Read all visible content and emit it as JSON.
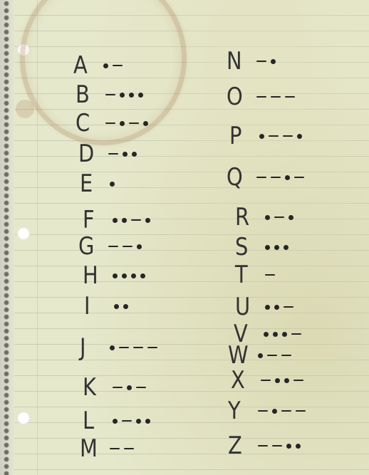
{
  "notebook": {
    "left_column": [
      {
        "letter": "A",
        "code": ".-"
      },
      {
        "letter": "B",
        "code": "-..."
      },
      {
        "letter": "C",
        "code": "-.-."
      },
      {
        "letter": "D",
        "code": "-.."
      },
      {
        "letter": "E",
        "code": "."
      },
      {
        "letter": "F",
        "code": "..-."
      },
      {
        "letter": "G",
        "code": "--."
      },
      {
        "letter": "H",
        "code": "...."
      },
      {
        "letter": "I",
        "code": ".."
      },
      {
        "letter": "J",
        "code": ".---"
      },
      {
        "letter": "K",
        "code": "-.-"
      },
      {
        "letter": "L",
        "code": ".-.."
      },
      {
        "letter": "M",
        "code": "--"
      }
    ],
    "right_column": [
      {
        "letter": "N",
        "code": "-."
      },
      {
        "letter": "O",
        "code": "---"
      },
      {
        "letter": "P",
        "code": ".--."
      },
      {
        "letter": "Q",
        "code": "--.-"
      },
      {
        "letter": "R",
        "code": ".-."
      },
      {
        "letter": "S",
        "code": "..."
      },
      {
        "letter": "T",
        "code": "-"
      },
      {
        "letter": "U",
        "code": "..-"
      },
      {
        "letter": "V",
        "code": "...-"
      },
      {
        "letter": "W",
        "code": ".--"
      },
      {
        "letter": "X",
        "code": "-..-"
      },
      {
        "letter": "Y",
        "code": "-.--"
      },
      {
        "letter": "Z",
        "code": "--.."
      }
    ]
  }
}
